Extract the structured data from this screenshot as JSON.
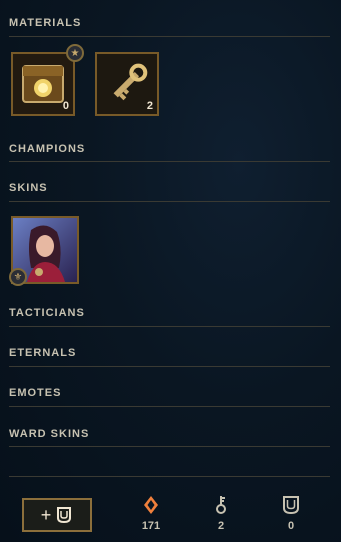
{
  "sections": {
    "materials": {
      "label": "MATERIALS"
    },
    "champions": {
      "label": "CHAMPIONS"
    },
    "skins": {
      "label": "SKINS"
    },
    "tacticians": {
      "label": "TACTICIANS"
    },
    "eternals": {
      "label": "ETERNALS"
    },
    "emotes": {
      "label": "EMOTES"
    },
    "ward_skins": {
      "label": "WARD SKINS"
    }
  },
  "materials_items": [
    {
      "name": "chest-item",
      "count": "0"
    },
    {
      "name": "key-item",
      "count": "2"
    }
  ],
  "footer": {
    "craft_button": "+",
    "blue_essence": "171",
    "keys": "2",
    "chests": "0"
  },
  "colors": {
    "accent_gold": "#c8aa6e",
    "essence_orange": "#f0803c"
  }
}
